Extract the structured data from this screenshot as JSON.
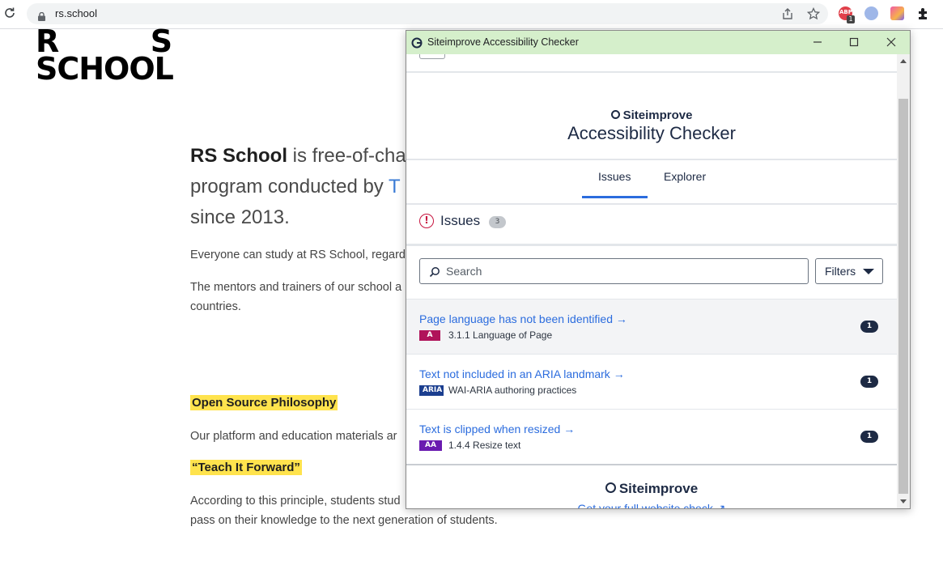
{
  "browser": {
    "url": "rs.school",
    "extension_badge": "1",
    "extension_label": "ABP"
  },
  "page": {
    "logo_line1": "R  S",
    "logo_line2": "SCHOOL",
    "hero_bold": "RS School",
    "hero_rest1": " is free-of-char",
    "hero_line2": "program conducted by ",
    "hero_link": "T",
    "hero_line3": "since 2013.",
    "para1": "Everyone can study at RS School, regard",
    "para2_l1": "The mentors and trainers of our school a",
    "para2_l2": "countries.",
    "h_open_source": "Open Source Philosophy",
    "para3": "Our platform and education materials ar",
    "h_teach": "“Teach It Forward”",
    "para4_l1": "According to this principle, students stud",
    "para4_l2": "pass on their knowledge to the next generation of students."
  },
  "popup": {
    "window_title": "Siteimprove Accessibility Checker",
    "brand_small": "Siteimprove",
    "brand_big": "Accessibility Checker",
    "tabs": [
      "Issues",
      "Explorer"
    ],
    "issues_title": "Issues",
    "issues_count": "3",
    "search_placeholder": "Search",
    "filters_label": "Filters",
    "issues": [
      {
        "title": "Page language has not been identified  →",
        "tag": "A",
        "tag_color": "#b0135a",
        "criterion": "3.1.1 Language of Page",
        "count": "1"
      },
      {
        "title": "Text not included in an ARIA landmark →",
        "tag": "ARIA",
        "tag_color": "#1b3e8f",
        "criterion": "WAI-ARIA authoring practices",
        "count": "1"
      },
      {
        "title": "Text is clipped when resized →",
        "tag": "AA",
        "tag_color": "#6a1bb0",
        "criterion": "1.4.4 Resize text",
        "count": "1"
      }
    ],
    "footer_brand": "Siteimprove",
    "footer_link": "Get your full website check ↗"
  },
  "colors": {
    "accent_blue": "#2b6cde",
    "title_bar_green": "#d5efcb",
    "highlight_yellow": "#ffe34d",
    "alert_red": "#c7153f"
  }
}
